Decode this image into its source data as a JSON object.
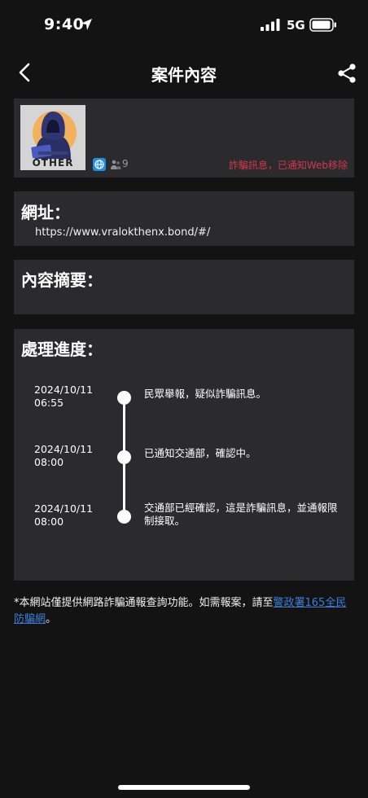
{
  "status_bar": {
    "time": "9:40",
    "network": "5G"
  },
  "nav": {
    "title": "案件內容"
  },
  "case": {
    "avatar_label": "OTHER",
    "reporter_count": "9",
    "status": "詐騙訊息，已通知Web移除"
  },
  "url_section": {
    "label": "網址：",
    "value": "https://www.vralokthenx.bond/#/"
  },
  "summary_section": {
    "label": "內容摘要："
  },
  "progress_section": {
    "label": "處理進度：",
    "items": [
      {
        "date": "2024/10/11\n06:55",
        "text": "民眾舉報，疑似詐騙訊息。"
      },
      {
        "date": "2024/10/11\n08:00",
        "text": "已通知交通部，確認中。"
      },
      {
        "date": "2024/10/11\n08:00",
        "text": "交通部已經確認，這是詐騙訊息，並通報限制接取。"
      }
    ]
  },
  "footer": {
    "text_before": "*本網站僅提供網路詐騙通報查詢功能。如需報案，請至",
    "link_text": "警政署165全民防騙網",
    "text_after": "。"
  },
  "colors": {
    "background": "#131313",
    "card": "#2b2b2d",
    "status_red": "#d0384f",
    "link_blue": "#3b7fd9",
    "badge_blue": "#1f8fe0"
  }
}
